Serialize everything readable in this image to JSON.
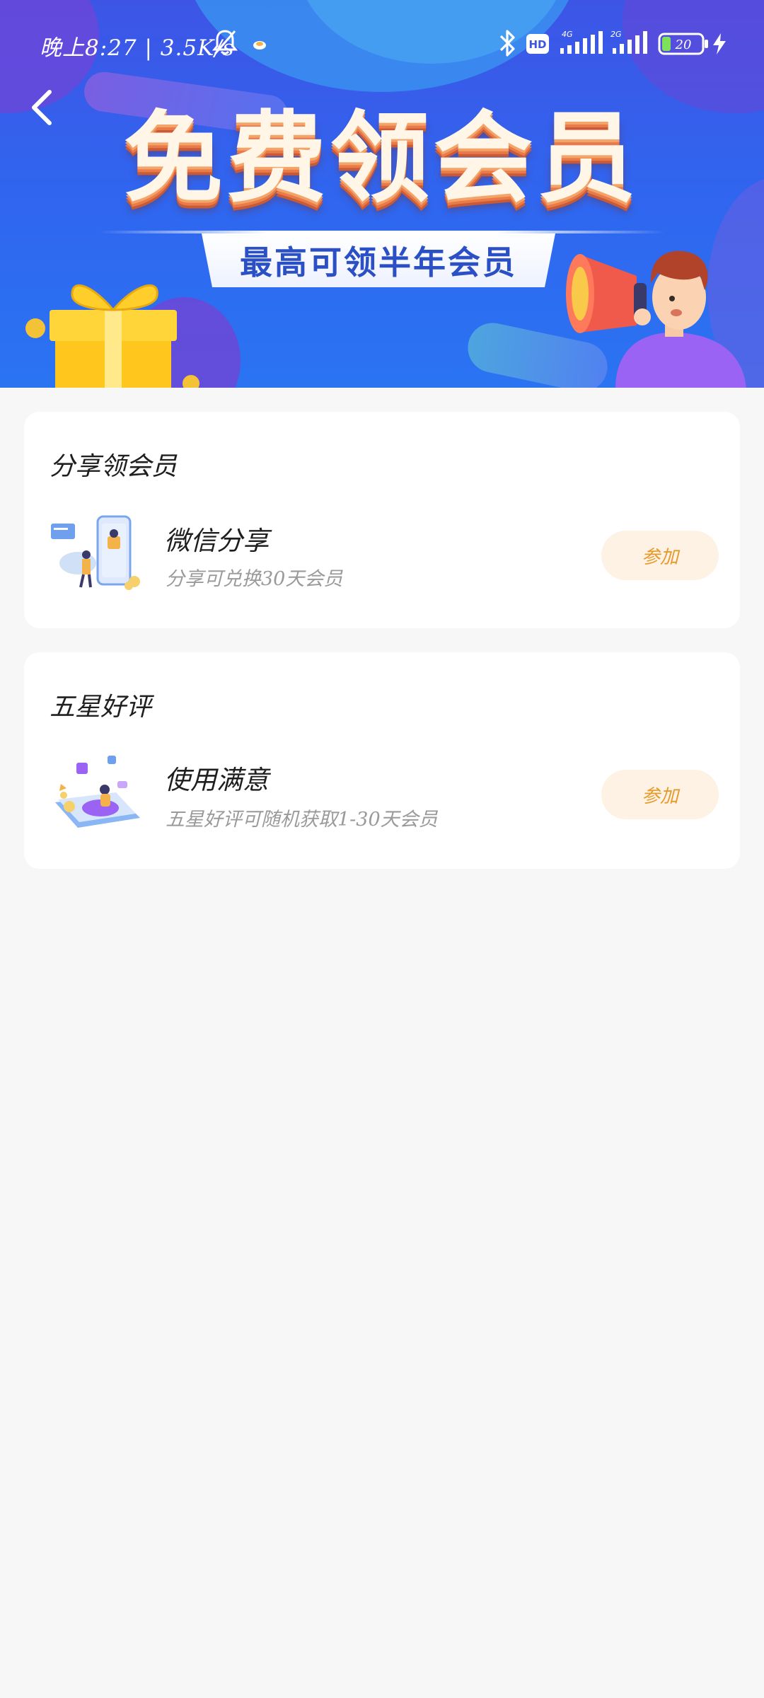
{
  "status_bar": {
    "time_and_speed": "晚上8:27 | 3.5K/s",
    "network_4g": "4G",
    "network_2": "2G",
    "battery_level": "20"
  },
  "banner": {
    "title": "免费领会员",
    "subtitle": "最高可领半年会员"
  },
  "sections": [
    {
      "heading": "分享领会员",
      "item": {
        "illustration": "phone-share-illustration",
        "title": "微信分享",
        "description": "分享可兑换30天会员",
        "button_label": "参加"
      }
    },
    {
      "heading": "五星好评",
      "item": {
        "illustration": "tablet-review-illustration",
        "title": "使用满意",
        "description": "五星好评可随机获取1-30天会员",
        "button_label": "参加"
      }
    }
  ],
  "colors": {
    "banner_blue": "#2f67f0",
    "page_background": "#f7f7f7",
    "button_background": "#fdf2e4",
    "button_text": "#e59a2c"
  },
  "icons": [
    "back-arrow-icon",
    "bell-muted-icon",
    "notification-icon",
    "bluetooth-icon",
    "hd-icon",
    "signal-icon",
    "battery-icon",
    "charging-icon"
  ]
}
